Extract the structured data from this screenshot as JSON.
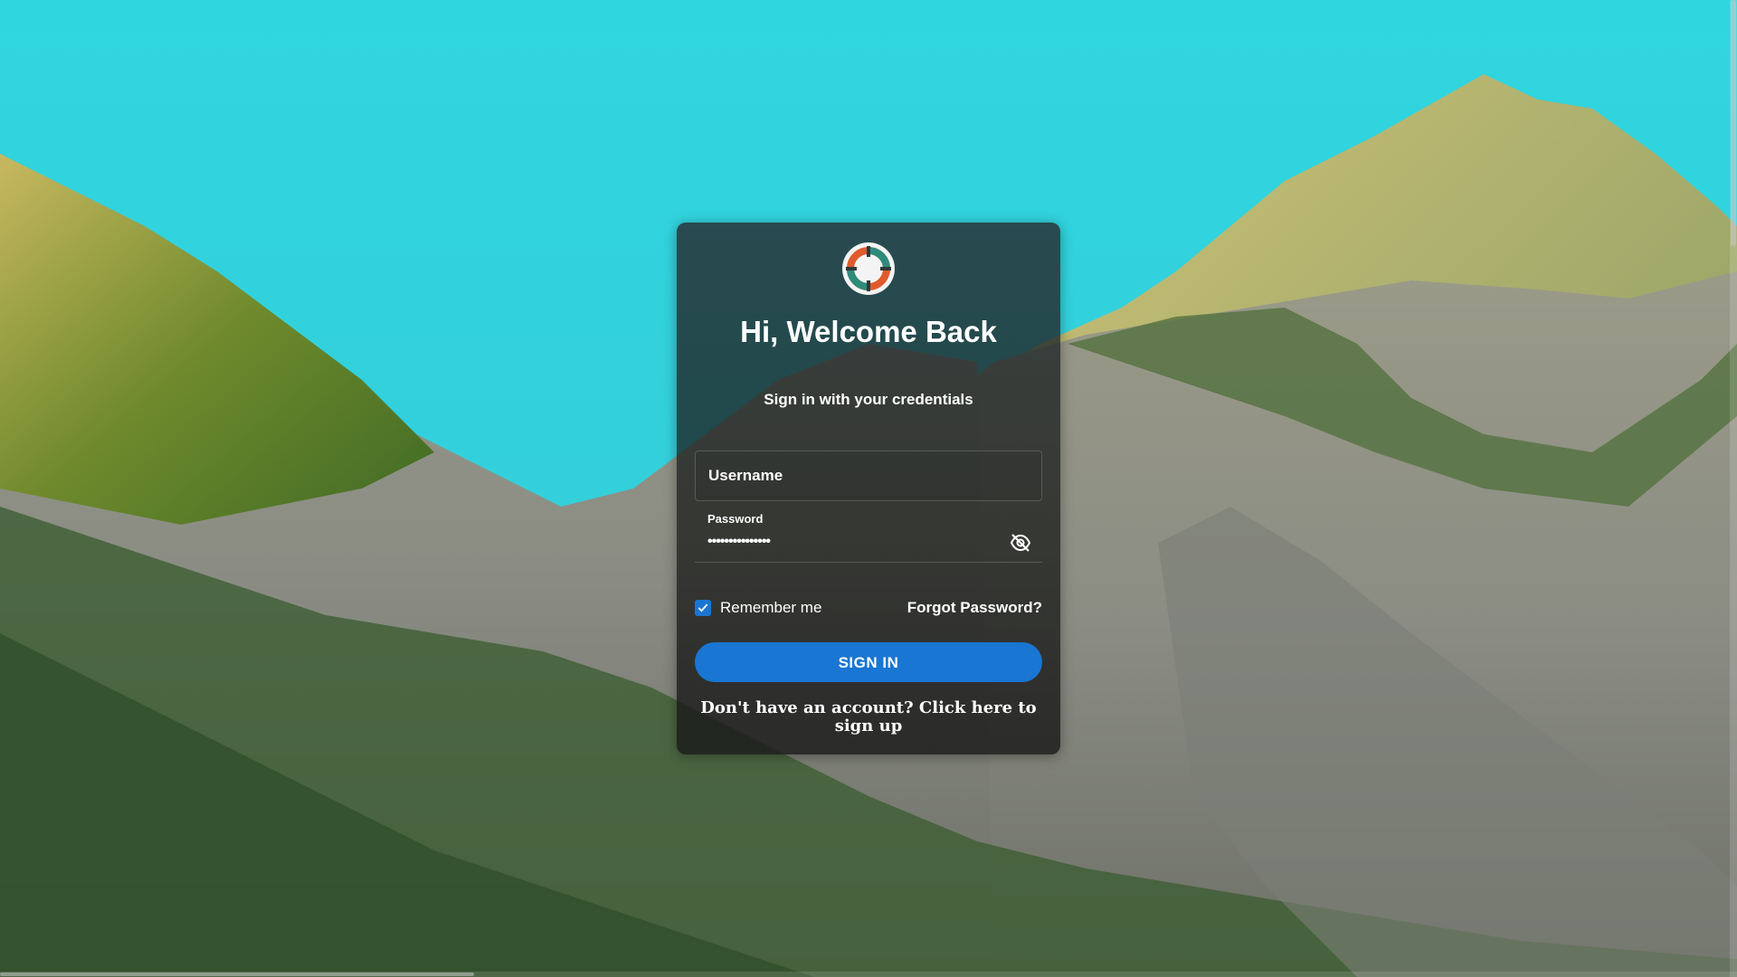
{
  "login": {
    "title": "Hi, Welcome Back",
    "subtitle": "Sign in with your credentials",
    "username": {
      "placeholder": "Username",
      "value": ""
    },
    "password": {
      "label": "Password",
      "value": "•••••••••••••••"
    },
    "remember_label": "Remember me",
    "remember_checked": true,
    "forgot_label": "Forgot Password?",
    "signin_label": "SIGN IN",
    "signup_text": "Don't have an account? Click here to sign up"
  },
  "icons": {
    "logo": "lifebuoy-logo-icon",
    "toggle_visibility": "eye-off-icon",
    "checkbox": "checkmark-icon"
  },
  "colors": {
    "accent": "#1976d2",
    "logo_orange": "#e05a2b",
    "logo_teal": "#2e8b7a"
  }
}
